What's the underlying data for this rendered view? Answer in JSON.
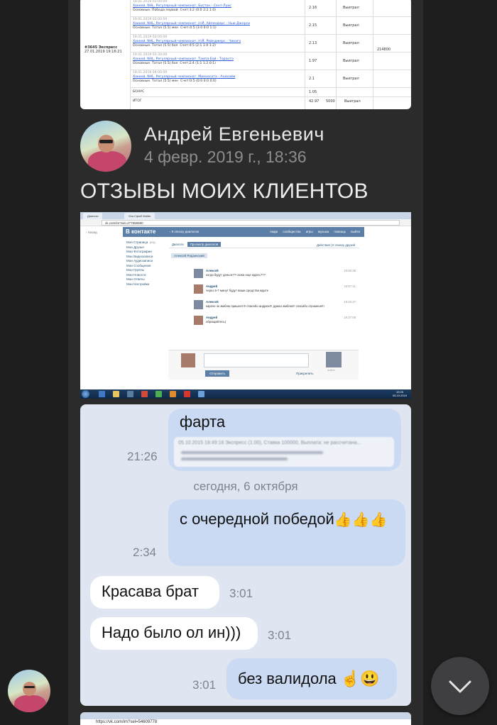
{
  "bet_table": {
    "coupon_id": "#3645 Экспресс",
    "coupon_date": "27.01.2019 19:16:21",
    "sum": "214800",
    "rows": [
      {
        "date": "18.01.2019 03:00:00",
        "event": "Хоккей. NHL. Регулярный чемпионат. Бостон - Сент-Луис",
        "market": "Основные. Победа первой",
        "score": "Счет:3:2 (0:0 2:2 1:0)",
        "odd": "2.16",
        "result": "Выиграл"
      },
      {
        "date": "19.01.2019 03:00:00",
        "event": "Хоккей. NHL. Регулярный чемпионат. Н.Й. Айлендерс - Нью-Джерси",
        "market": "Основные. Тотал (5.5) мен",
        "score": "Счет:4:5 (3:0 0:0 1:1)",
        "odd": "2.15",
        "result": "Выиграл"
      },
      {
        "date": "19.01.2019 03:00:00",
        "event": "Хоккей. NHL. Регулярный чемпионат. Н.Й. Рейнджерс - Чикаго",
        "market": "Основные. Тотал (5.5) бол",
        "score": "Счет:4:5 (2:1 1:0 1:2)",
        "odd": "2.13",
        "result": "Выиграл"
      },
      {
        "date": "19.01.2019 03:30:00",
        "event": "Хоккей. NHL. Регулярный чемпионат. Тампа-Бэй - Торонто",
        "market": "Основные. Тотал (5.5) бол",
        "score": "Счет:2:4 (1:1 1:2 0:1)",
        "odd": "1.97",
        "result": "Выиграл"
      },
      {
        "date": "18.01.2019 04:00:00",
        "event": "Хоккей. NHL. Регулярный чемпионат. Миннесота - Анахайм",
        "market": "Основные. Тотал (5.5) мен",
        "score": "Счет:0:5 (0:0 0:0 0:0)",
        "odd": "2.1",
        "result": "Выиграл"
      }
    ],
    "bonus_label": "БОНУС",
    "bonus_value": "1.05",
    "total_label": "ИТОГ",
    "total_odd": "42.97",
    "total_stake": "5000",
    "total_result": "Выиграл"
  },
  "post": {
    "author": "Андрей Евгеньевич",
    "date": "4 февр. 2019 г., 18:36",
    "text": "ОТЗЫВЫ МОИХ КЛИЕНТОВ"
  },
  "vk_screenshot": {
    "tabs": [
      "Диалоги",
      "Vеа Сфаб Walter"
    ],
    "url": "vk.com/im?sel=277655590",
    "logo": "В контакте",
    "back_to_list": "К списку диалогов",
    "goback": "Назад",
    "nav": [
      "люди",
      "сообщества",
      "игры",
      "музыка",
      "помощь",
      "выйти"
    ],
    "menu": [
      "Моя Страница",
      "Мои Друзья",
      "Мои Фотографии",
      "Мои Видеозаписи",
      "Мои Аудиозаписи",
      "Мои Сообщения",
      "Мои Группы",
      "Мои Новости",
      "Мои Ответы",
      "Мои Настройки"
    ],
    "menu_edit": "ред.",
    "dialog_tabs": [
      "Диалоги",
      "Просмотр диалогов"
    ],
    "dialog_actions": "Действия | К списку друзей",
    "chat_with": "Алексей Родзинский",
    "messages": [
      {
        "name": "Алексей",
        "text": "когда будут деньги?? скока еще ждать???",
        "time": "19:55:38"
      },
      {
        "name": "Андрей",
        "text": "через 5-7 минут будут ваши средства ждите",
        "time": "19:57:11"
      },
      {
        "name": "Алексей",
        "text": "кароче ок жмблю пришлет!!! спасибо андрюх!!! думал жмблю!!! спасибо огромное!!!",
        "time": "19:33:27"
      },
      {
        "name": "Андрей",
        "text": "обращайтесь)",
        "time": "19:37:08"
      }
    ],
    "send_label": "Отправить",
    "attach_label": "Прикрепить",
    "online_label": "online",
    "clock_time": "19:25",
    "clock_date": "05.10.2015"
  },
  "chat": {
    "date_separator": "сегодня, 6 октября",
    "messages": [
      {
        "id": "m1",
        "dir": "out",
        "text": "фарта",
        "quote": "05.10.2015 18:49:18 Экспресс (1.00), Ставка 100000, Выплата: не рассчитана...",
        "time": "21:26"
      },
      {
        "id": "m2",
        "dir": "out",
        "text": "с очередной победой",
        "emoji": "👍👍👍",
        "time": "2:34"
      },
      {
        "id": "m3",
        "dir": "in",
        "text": "Красава брат",
        "time": "3:01"
      },
      {
        "id": "m4",
        "dir": "in",
        "text": "Надо было ол ин)))",
        "time": "3:01"
      },
      {
        "id": "m5",
        "dir": "out",
        "text": "без валидола",
        "emoji": "☝😃",
        "time": "3:01"
      }
    ]
  },
  "next_screenshot": {
    "url": "https://vk.com/im?sel=54609778"
  },
  "scroll_button": {
    "icon": "chevron-down-icon"
  },
  "colors": {
    "background": "#1e1e1f",
    "out_bubble": "#cbdaf3",
    "in_bubble": "#ffffff",
    "link": "#2a5bd7"
  }
}
